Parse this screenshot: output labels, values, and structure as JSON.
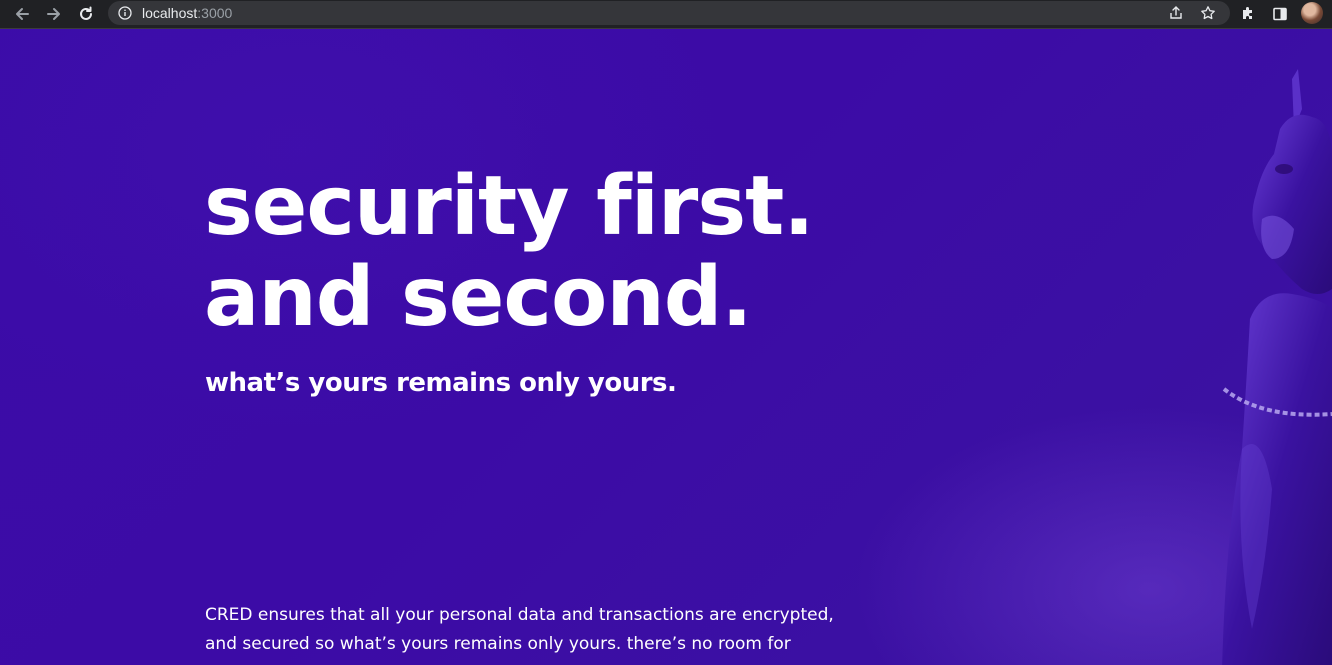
{
  "browser": {
    "url_host": "localhost",
    "url_port": ":3000",
    "icons": [
      "back-arrow-icon",
      "forward-arrow-icon",
      "reload-icon",
      "info-icon",
      "share-icon",
      "star-icon",
      "extensions-icon",
      "side-panel-icon",
      "profile-avatar"
    ]
  },
  "hero": {
    "headline_line1": "security first.",
    "headline_line2": "and second.",
    "subheadline": "what’s yours remains only yours.",
    "body": "CRED ensures that all your personal data and transactions are encrypted, and secured so what’s yours remains only yours. there’s no room for mistakes because we didn’t leave any."
  },
  "colors": {
    "background": "#3a0ca3",
    "text": "#ffffff",
    "chrome_bar": "#202124",
    "omnibox": "#35363a"
  }
}
